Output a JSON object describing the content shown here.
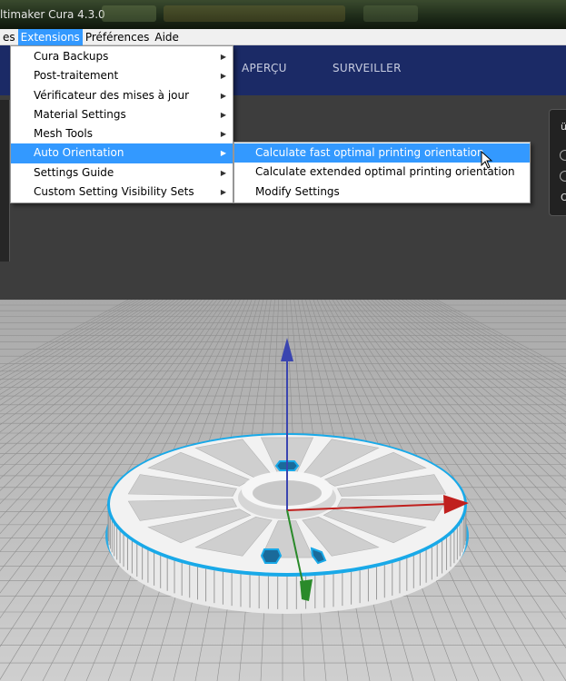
{
  "window": {
    "title": "ltimaker Cura 4.3.0"
  },
  "menubar": {
    "items": [
      {
        "label": "es",
        "active": false
      },
      {
        "label": "Extensions",
        "active": true
      },
      {
        "label": "Préférences",
        "active": false
      },
      {
        "label": "Aide",
        "active": false
      }
    ]
  },
  "header": {
    "tabs": [
      {
        "label": "APERÇU"
      },
      {
        "label": "SURVEILLER"
      }
    ]
  },
  "extensions_menu": {
    "items": [
      {
        "label": "Cura Backups"
      },
      {
        "label": "Post-traitement"
      },
      {
        "label": "Vérificateur des mises à jour"
      },
      {
        "label": "Material Settings"
      },
      {
        "label": "Mesh Tools"
      },
      {
        "label": "Auto Orientation"
      },
      {
        "label": "Settings Guide"
      },
      {
        "label": "Custom Setting Visibility Sets"
      }
    ],
    "highlighted": "Auto Orientation"
  },
  "auto_orientation_submenu": {
    "items": [
      {
        "label": "Calculate fast optimal printing orientation"
      },
      {
        "label": "Calculate extended optimal printing orientation"
      },
      {
        "label": "Modify Settings"
      }
    ],
    "highlighted": "Calculate fast optimal printing orientation"
  },
  "right_panel": {
    "label": "ü",
    "caption": "O"
  },
  "colors": {
    "header": "#1b2a66",
    "menu_highlight": "#3399ff",
    "axis_x": "#c0201e",
    "axis_y": "#2a8a2a",
    "axis_z": "#3a45b0",
    "outline": "#19a9e8"
  }
}
